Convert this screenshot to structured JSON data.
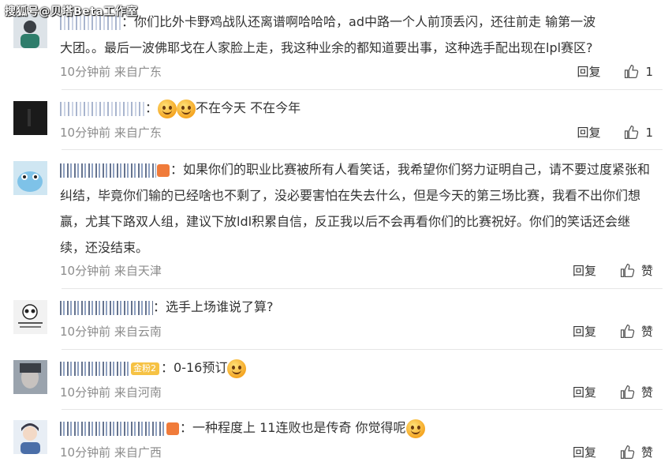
{
  "watermark": "搜狐号@贝塔Beta工作室",
  "comments": [
    {
      "prefix": "：",
      "text_line1": "你们比外卡野鸡战队还离谱啊哈哈哈，ad中路一个人前顶丢闪，还往前走 输第一波",
      "text_rest": "大团。。最后一波佛耶戈在人家脸上走，我这种业余的都知道要出事，这种选手配出现在lpl赛区?",
      "time": "10分钟前",
      "source": "来自广东",
      "reply": "回复",
      "likes": "1"
    },
    {
      "prefix": "：",
      "text": "不在今天 不在今年",
      "time": "10分钟前",
      "source": "来自广东",
      "reply": "回复",
      "likes": "1"
    },
    {
      "prefix": "：",
      "text": "如果你们的职业比赛被所有人看笑话，我希望你们努力证明自己，请不要过度紧张和纠结，毕竟你们输的已经啥也不剩了，没必要害怕在失去什么，但是今天的第三场比赛，我看不出你们想赢，尤其下路双人组，建议下放ldl积累自信，反正我以后不会再看你们的比赛祝好。你们的笑话还会继续，还没结束。",
      "time": "10分钟前",
      "source": "来自天津",
      "reply": "回复",
      "likes": "赞"
    },
    {
      "prefix": "：",
      "text": "选手上场谁说了算?",
      "time": "10分钟前",
      "source": "来自云南",
      "reply": "回复",
      "likes": "赞"
    },
    {
      "badge": "金粉2",
      "prefix": "：",
      "text": "0-16预订",
      "time": "10分钟前",
      "source": "来自河南",
      "reply": "回复",
      "likes": "赞"
    },
    {
      "prefix": "：",
      "text": "一种程度上 11连败也是传奇 你觉得呢",
      "time": "10分钟前",
      "source": "来自广西",
      "reply": "回复",
      "likes": "赞"
    }
  ]
}
